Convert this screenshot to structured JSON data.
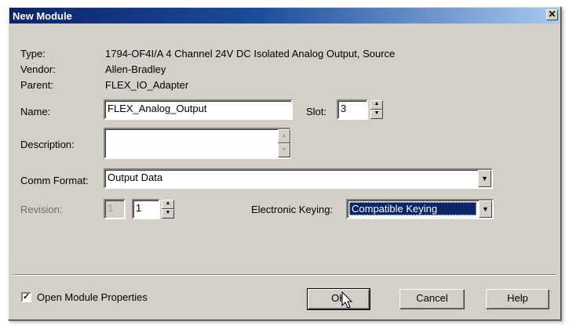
{
  "window": {
    "title": "New Module",
    "close_glyph": "✕"
  },
  "labels": {
    "type": "Type:",
    "vendor": "Vendor:",
    "parent": "Parent:",
    "name": "Name:",
    "slot": "Slot:",
    "description": "Description:",
    "comm_format": "Comm Format:",
    "revision": "Revision:",
    "electronic_keying": "Electronic Keying:"
  },
  "values": {
    "type": "1794-OF4I/A 4 Channel 24V DC Isolated Analog Output, Source",
    "vendor": "Allen-Bradley",
    "parent": "FLEX_IO_Adapter",
    "name": "FLEX_Analog_Output",
    "slot": "3",
    "description": "",
    "comm_format": "Output Data",
    "revision_major": "1",
    "revision_minor": "1",
    "electronic_keying": "Compatible Keying"
  },
  "checkbox": {
    "label": "Open Module Properties",
    "checked": true,
    "mark": "✓"
  },
  "buttons": {
    "ok": "OK",
    "cancel": "Cancel",
    "help": "Help"
  },
  "glyphs": {
    "spin_up": "▲",
    "spin_down": "▼",
    "dropdown": "▼"
  },
  "colors": {
    "titlebar_start": "#0a246a",
    "titlebar_end": "#a6caf0",
    "dialog_bg": "#d4d0c8",
    "selection": "#0a246a"
  }
}
